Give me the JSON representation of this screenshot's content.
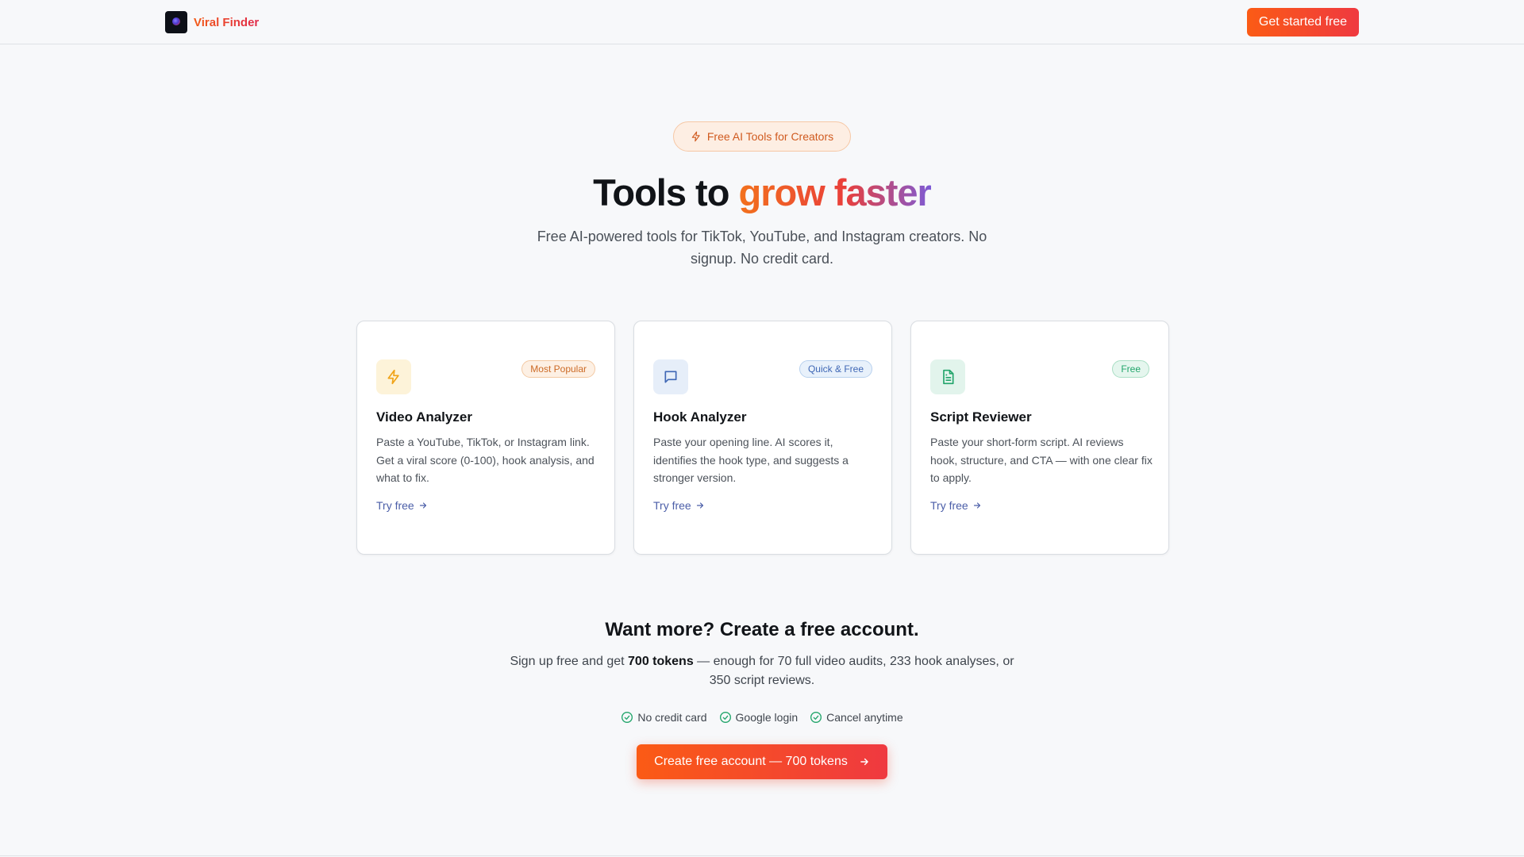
{
  "header": {
    "brand_name": "Viral Finder",
    "cta_label": "Get started free"
  },
  "hero": {
    "badge": "Free AI Tools for Creators",
    "title_prefix": "Tools to ",
    "title_highlight": "grow faster",
    "subtitle": "Free AI-powered tools for TikTok, YouTube, and Instagram creators. No signup. No credit card."
  },
  "tools": [
    {
      "icon": "lightning-icon",
      "badge": "Most Popular",
      "title": "Video Analyzer",
      "description": "Paste a YouTube, TikTok, or Instagram link. Get a viral score (0-100), hook analysis, and what to fix.",
      "link": "Try free"
    },
    {
      "icon": "chat-bubble-icon",
      "badge": "Quick & Free",
      "title": "Hook Analyzer",
      "description": "Paste your opening line. AI scores it, identifies the hook type, and suggests a stronger version.",
      "link": "Try free"
    },
    {
      "icon": "document-icon",
      "badge": "Free",
      "title": "Script Reviewer",
      "description": "Paste your short-form script. AI reviews hook, structure, and CTA — with one clear fix to apply.",
      "link": "Try free"
    }
  ],
  "signup": {
    "title": "Want more? Create a free account.",
    "subtitle_before": "Sign up free and get ",
    "subtitle_bold": "700 tokens",
    "subtitle_after": " — enough for 70 full video audits, 233 hook analyses, or 350 script reviews.",
    "checks": [
      "No credit card",
      "Google login",
      "Cancel anytime"
    ],
    "button_label": "Create free account — 700 tokens"
  },
  "colors": {
    "accent_orange": "#fb5b15",
    "accent_red": "#ef3940",
    "link_blue": "#4b5ea8",
    "check_green": "#22a56b"
  }
}
